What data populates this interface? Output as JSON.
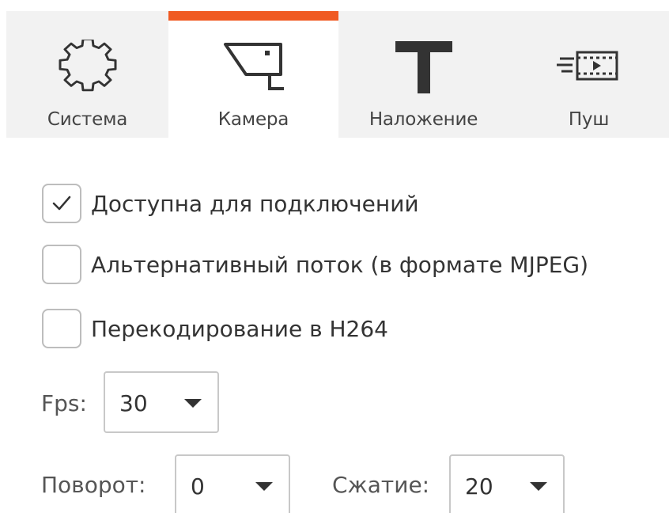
{
  "tabs": [
    {
      "label": "Система",
      "icon": "gear-icon",
      "active": false
    },
    {
      "label": "Камера",
      "icon": "camera-icon",
      "active": true
    },
    {
      "label": "Наложение",
      "icon": "text-overlay-icon",
      "active": false
    },
    {
      "label": "Пуш",
      "icon": "push-video-icon",
      "active": false
    }
  ],
  "accent_color": "#f05a22",
  "options": [
    {
      "label": "Доступна для подключений",
      "checked": true
    },
    {
      "label": "Альтернативный поток (в формате MJPEG)",
      "checked": false
    },
    {
      "label": "Перекодирование в H264",
      "checked": false
    }
  ],
  "fps": {
    "label": "Fps:",
    "value": "30"
  },
  "rotation": {
    "label": "Поворот:",
    "value": "0"
  },
  "compression": {
    "label": "Сжатие:",
    "value": "20"
  }
}
